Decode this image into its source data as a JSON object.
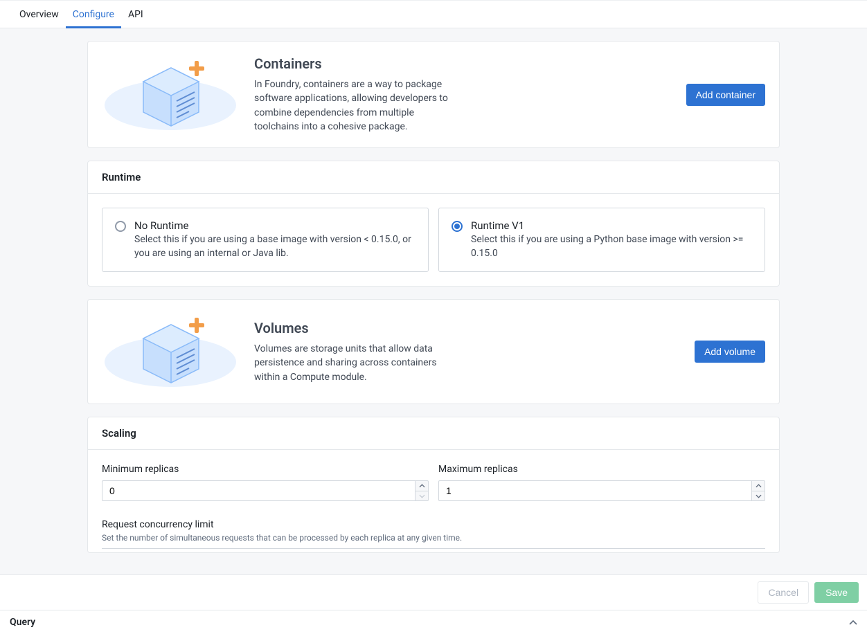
{
  "tabs": {
    "overview": "Overview",
    "configure": "Configure",
    "api": "API"
  },
  "containers": {
    "title": "Containers",
    "desc": "In Foundry, containers are a way to package software applications, allowing developers to combine dependencies from multiple toolchains into a cohesive package.",
    "button": "Add container"
  },
  "runtime": {
    "header": "Runtime",
    "none": {
      "title": "No Runtime",
      "desc": "Select this if you are using a base image with version < 0.15.0, or you are using an internal or Java lib."
    },
    "v1": {
      "title": "Runtime V1",
      "desc": "Select this if you are using a Python base image with version >= 0.15.0"
    }
  },
  "volumes": {
    "title": "Volumes",
    "desc": "Volumes are storage units that allow data persistence and sharing across containers within a Compute module.",
    "button": "Add volume"
  },
  "scaling": {
    "header": "Scaling",
    "min_label": "Minimum replicas",
    "min_value": "0",
    "max_label": "Maximum replicas",
    "max_value": "1",
    "concurrency_label": "Request concurrency limit",
    "concurrency_help": "Set the number of simultaneous requests that can be processed by each replica at any given time."
  },
  "footer": {
    "cancel": "Cancel",
    "save": "Save"
  },
  "query": {
    "label": "Query"
  }
}
